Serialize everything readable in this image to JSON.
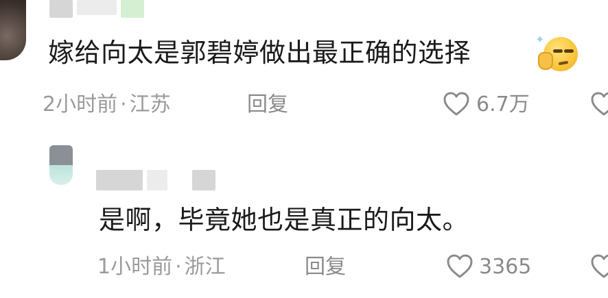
{
  "comments": [
    {
      "text": "嫁给向太是郭碧婷做出最正确的选择",
      "emoji": "smirk-thinking-emoji",
      "time": "2小时前",
      "separator": "·",
      "location": "江苏",
      "reply_label": "回复",
      "likes": "6.7万"
    },
    {
      "text": "是啊，毕竟她也是真正的向太。",
      "time": "1小时前",
      "separator": "·",
      "location": "浙江",
      "reply_label": "回复",
      "likes": "3365"
    }
  ],
  "colors": {
    "text": "#1a1a1a",
    "meta": "#9a9a9a",
    "icon": "#8a8a8a",
    "background": "#ffffff"
  },
  "icons": [
    "heart-icon",
    "heart-icon-partial"
  ]
}
